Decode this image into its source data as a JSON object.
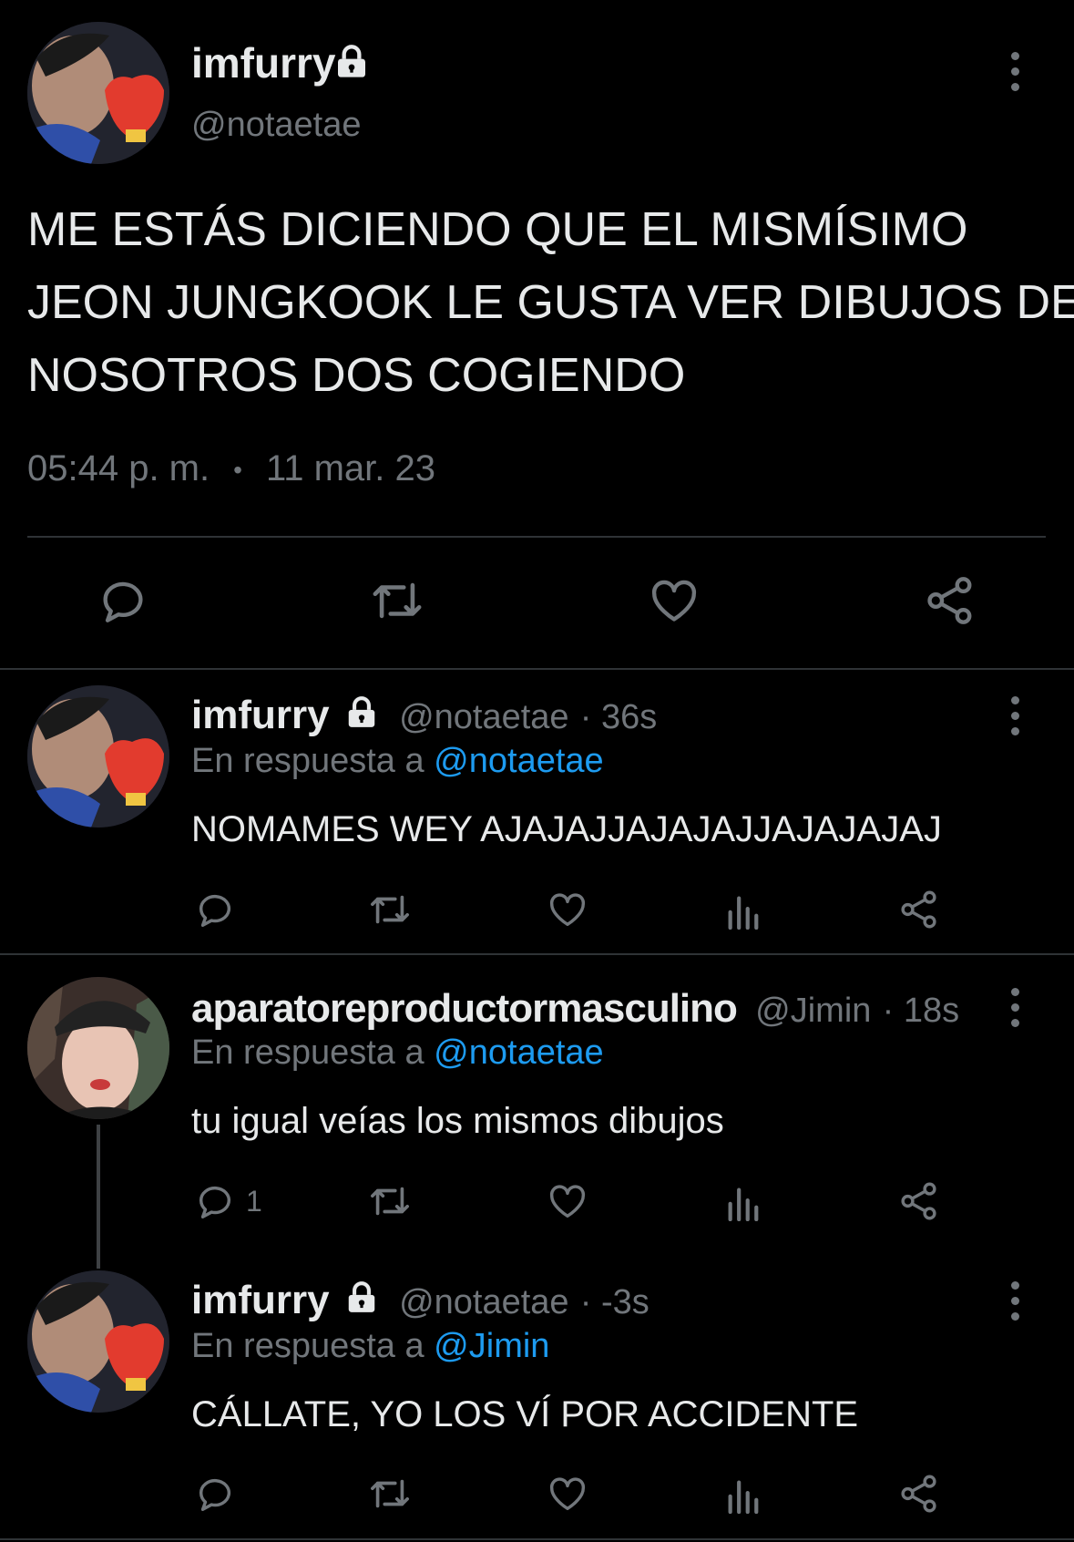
{
  "main_tweet": {
    "display_name": "imfurry",
    "handle": "@notaetae",
    "text_line1": "ME ESTÁS DICIENDO QUE EL MISMÍSIMO",
    "text_line2": "JEON JUNGKOOK LE GUSTA VER DIBUJOS DE",
    "text_line3": "NOSOTROS DOS COGIENDO",
    "time": "05:44 p. m.",
    "separator": "•",
    "date": "11 mar. 23"
  },
  "replies": [
    {
      "display_name": "imfurry",
      "handle": "@notaetae",
      "time": "· 36s",
      "reply_prefix": "En respuesta a",
      "reply_to": "@notaetae",
      "text": "NOMAMES WEY AJAJAJJAJAJAJJAJAJAJAJ",
      "reply_count": ""
    },
    {
      "display_name": "aparatoreproductormasculino",
      "handle": "@Jimin",
      "time": "· 18s",
      "reply_prefix": "En respuesta a",
      "reply_to": "@notaetae",
      "text": "tu igual veías los mismos dibujos",
      "reply_count": "1"
    },
    {
      "display_name": "imfurry",
      "handle": "@notaetae",
      "time": "· -3s",
      "reply_prefix": "En respuesta a",
      "reply_to": "@Jimin",
      "text": "CÁLLATE, YO LOS VÍ POR ACCIDENTE",
      "reply_count": ""
    }
  ],
  "icons": [
    "lock-icon",
    "more-icon",
    "reply-icon",
    "retweet-icon",
    "like-icon",
    "share-icon",
    "views-icon"
  ],
  "colors": {
    "background": "#000000",
    "text": "#e7e9ea",
    "muted": "#71767b",
    "link": "#1d9bf0",
    "divider": "#2f3336"
  }
}
